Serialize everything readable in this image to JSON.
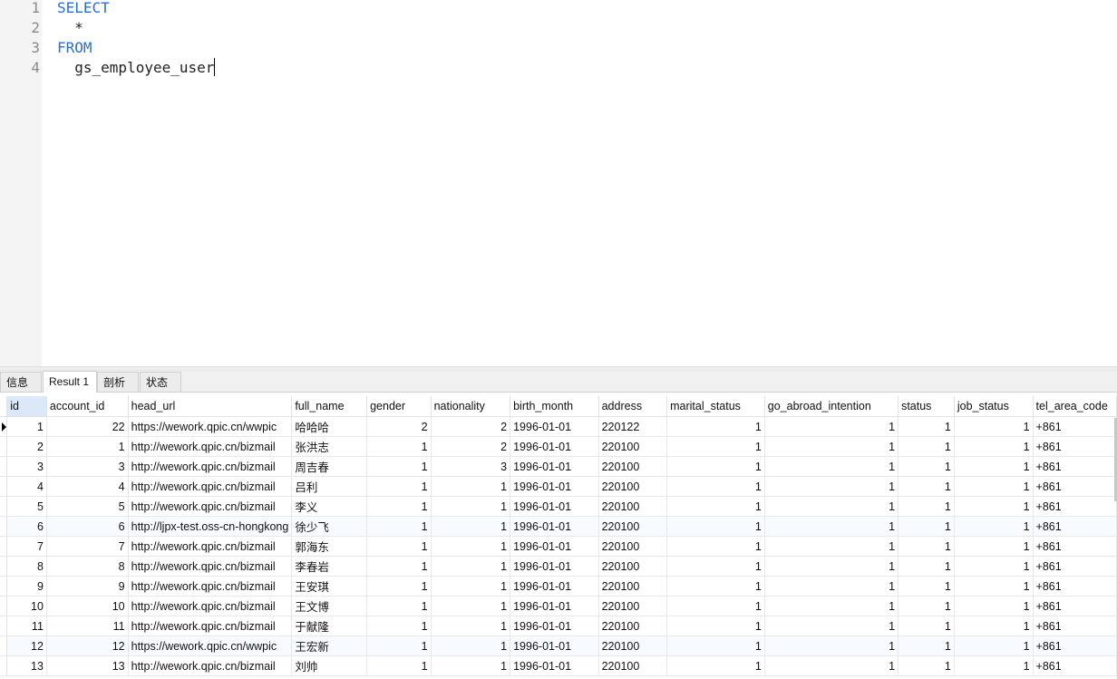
{
  "editor": {
    "line_numbers": [
      "1",
      "2",
      "3",
      "4"
    ],
    "lines": [
      {
        "text": "SELECT",
        "indent": "",
        "keyword": true
      },
      {
        "text": "*",
        "indent": "  ",
        "keyword": false
      },
      {
        "text": "FROM",
        "indent": "",
        "keyword": true
      },
      {
        "text": "gs_employee_user",
        "indent": "  ",
        "keyword": false
      }
    ]
  },
  "tabs": [
    {
      "label": "信息",
      "active": false
    },
    {
      "label": "Result 1",
      "active": true
    },
    {
      "label": "剖析",
      "active": false
    },
    {
      "label": "状态",
      "active": false
    }
  ],
  "grid": {
    "columns": [
      "id",
      "account_id",
      "head_url",
      "full_name",
      "gender",
      "nationality",
      "birth_month",
      "address",
      "marital_status",
      "go_abroad_intention",
      "status",
      "job_status",
      "tel_area_code"
    ],
    "selected_column": "id",
    "current_row": 0,
    "rows": [
      [
        "1",
        "22",
        "https://wework.qpic.cn/wwpic",
        "哈哈哈",
        "2",
        "2",
        "1996-01-01",
        "220122",
        "1",
        "1",
        "1",
        "1",
        "+861"
      ],
      [
        "2",
        "1",
        "http://wework.qpic.cn/bizmail",
        "张洪志",
        "1",
        "2",
        "1996-01-01",
        "220100",
        "1",
        "1",
        "1",
        "1",
        "+861"
      ],
      [
        "3",
        "3",
        "http://wework.qpic.cn/bizmail",
        "周吉春",
        "1",
        "3",
        "1996-01-01",
        "220100",
        "1",
        "1",
        "1",
        "1",
        "+861"
      ],
      [
        "4",
        "4",
        "http://wework.qpic.cn/bizmail",
        "吕利",
        "1",
        "1",
        "1996-01-01",
        "220100",
        "1",
        "1",
        "1",
        "1",
        "+861"
      ],
      [
        "5",
        "5",
        "http://wework.qpic.cn/bizmail",
        "李义",
        "1",
        "1",
        "1996-01-01",
        "220100",
        "1",
        "1",
        "1",
        "1",
        "+861"
      ],
      [
        "6",
        "6",
        "http://ljpx-test.oss-cn-hongkong",
        "徐少飞",
        "1",
        "1",
        "1996-01-01",
        "220100",
        "1",
        "1",
        "1",
        "1",
        "+861"
      ],
      [
        "7",
        "7",
        "http://wework.qpic.cn/bizmail",
        "郭海东",
        "1",
        "1",
        "1996-01-01",
        "220100",
        "1",
        "1",
        "1",
        "1",
        "+861"
      ],
      [
        "8",
        "8",
        "http://wework.qpic.cn/bizmail",
        "李春岩",
        "1",
        "1",
        "1996-01-01",
        "220100",
        "1",
        "1",
        "1",
        "1",
        "+861"
      ],
      [
        "9",
        "9",
        "http://wework.qpic.cn/bizmail",
        "王安琪",
        "1",
        "1",
        "1996-01-01",
        "220100",
        "1",
        "1",
        "1",
        "1",
        "+861"
      ],
      [
        "10",
        "10",
        "http://wework.qpic.cn/bizmail",
        "王文博",
        "1",
        "1",
        "1996-01-01",
        "220100",
        "1",
        "1",
        "1",
        "1",
        "+861"
      ],
      [
        "11",
        "11",
        "http://wework.qpic.cn/bizmail",
        "于献隆",
        "1",
        "1",
        "1996-01-01",
        "220100",
        "1",
        "1",
        "1",
        "1",
        "+861"
      ],
      [
        "12",
        "12",
        "https://wework.qpic.cn/wwpic",
        "王宏新",
        "1",
        "1",
        "1996-01-01",
        "220100",
        "1",
        "1",
        "1",
        "1",
        "+861"
      ],
      [
        "13",
        "13",
        "http://wework.qpic.cn/bizmail",
        "刘帅",
        "1",
        "1",
        "1996-01-01",
        "220100",
        "1",
        "1",
        "1",
        "1",
        "+861"
      ]
    ]
  }
}
